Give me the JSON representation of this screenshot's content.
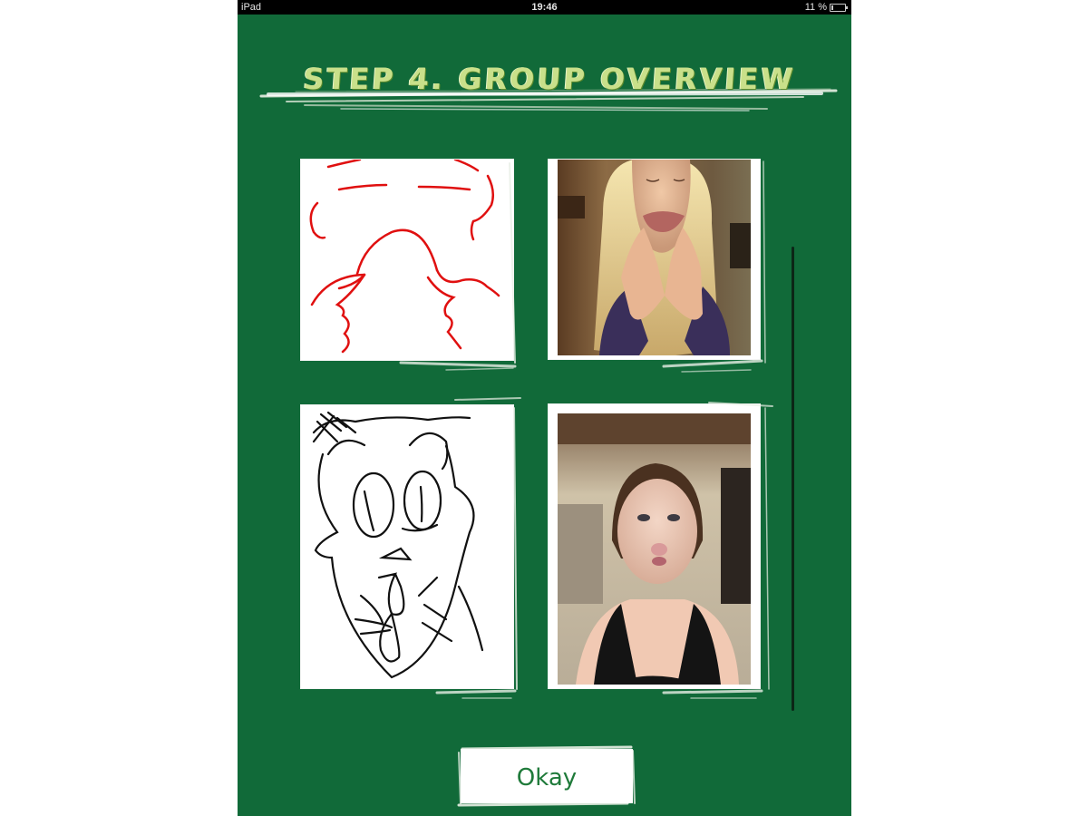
{
  "status_bar": {
    "device": "iPad",
    "time": "19:46",
    "battery": "11 %",
    "battery_level": 0.11
  },
  "header": {
    "title": "STEP 4. GROUP OVERVIEW"
  },
  "tiles": [
    {
      "kind": "drawing",
      "name": "red-face-drawing",
      "stroke_color": "#e01010"
    },
    {
      "kind": "photo",
      "name": "photo-woman-fingers-mouth"
    },
    {
      "kind": "drawing",
      "name": "black-face-drawing",
      "stroke_color": "#111111"
    },
    {
      "kind": "photo",
      "name": "photo-woman-puckered-lips"
    }
  ],
  "actions": {
    "okay_label": "Okay"
  },
  "colors": {
    "background": "#116a39",
    "title": "#c9e08a",
    "button_text": "#1f7a3a"
  }
}
